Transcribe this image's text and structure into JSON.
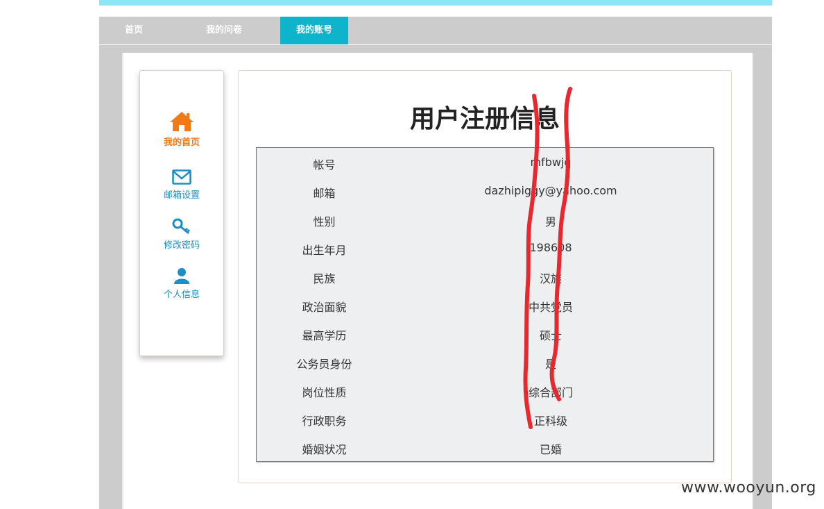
{
  "nav": {
    "items": [
      {
        "label": "首页"
      },
      {
        "label": "我的问卷"
      },
      {
        "label": "我的账号"
      }
    ],
    "active_index": 2,
    "active_color": "#0db4cc"
  },
  "sidebar": {
    "items": [
      {
        "label": "我的首页",
        "icon": "home-icon",
        "color": "#f07a1a"
      },
      {
        "label": "邮箱设置",
        "icon": "envelope-icon",
        "color": "#1a8fc7"
      },
      {
        "label": "修改密码",
        "icon": "key-icon",
        "color": "#1a8fc7"
      },
      {
        "label": "个人信息",
        "icon": "user-icon",
        "color": "#1a8fc7"
      }
    ]
  },
  "main": {
    "title": "用户注册信息",
    "rows": [
      {
        "label": "帐号",
        "value": "mfbwjq"
      },
      {
        "label": "邮箱",
        "value": "dazhipiggy@yahoo.com"
      },
      {
        "label": "性别",
        "value": "男"
      },
      {
        "label": "出生年月",
        "value": "198608"
      },
      {
        "label": "民族",
        "value": "汉族"
      },
      {
        "label": "政治面貌",
        "value": "中共党员"
      },
      {
        "label": "最高学历",
        "value": "硕士"
      },
      {
        "label": "公务员身份",
        "value": "是"
      },
      {
        "label": "岗位性质",
        "value": "综合部门"
      },
      {
        "label": "行政职务",
        "value": "正科级"
      },
      {
        "label": "婚姻状况",
        "value": "已婚"
      }
    ]
  },
  "watermark": "www.wooyun.org",
  "colors": {
    "redaction": "#e8282e",
    "topbar": "#8ce6f5",
    "nav_bg": "#cccccc"
  }
}
